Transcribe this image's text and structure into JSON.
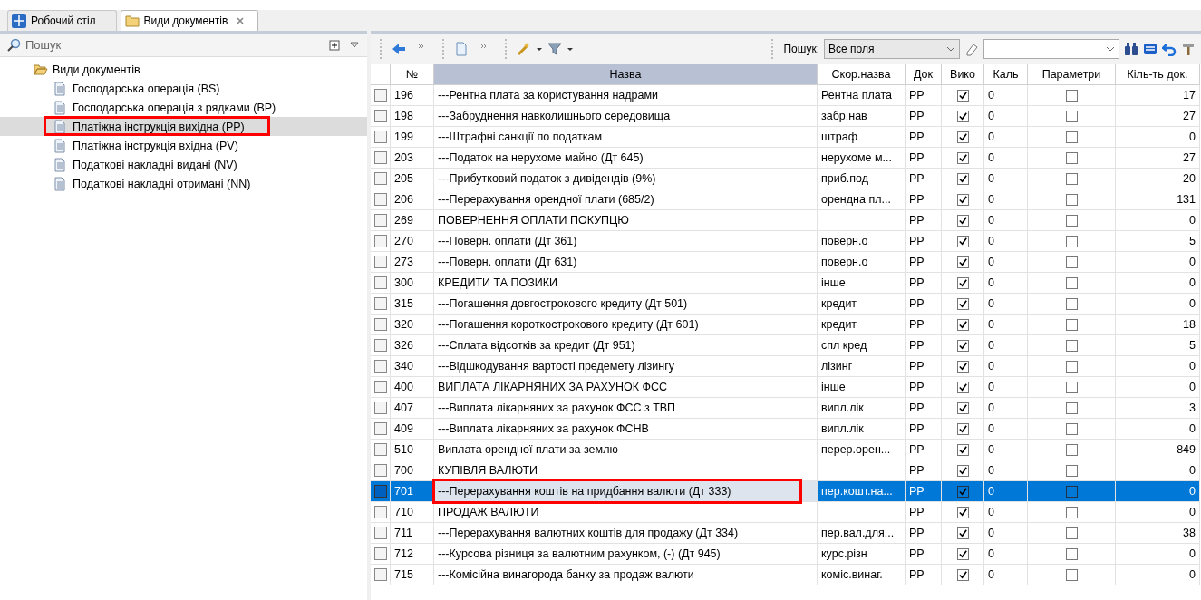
{
  "tabs": [
    {
      "label": "Робочий стіл",
      "selected": false,
      "closable": false
    },
    {
      "label": "Види документів",
      "selected": true,
      "closable": true
    }
  ],
  "left_panel": {
    "search_label": "Пошук",
    "tree": [
      {
        "label": "Види документів",
        "expanded": true,
        "children": [
          {
            "label": "Господарська операція (BS)",
            "selected": false,
            "annotated": false
          },
          {
            "label": "Господарська операція з рядками (BP)",
            "selected": false,
            "annotated": false
          },
          {
            "label": "Платіжна інструкція вихідна (PP)",
            "selected": true,
            "annotated": true
          },
          {
            "label": "Платіжна інструкція вхідна (PV)",
            "selected": false,
            "annotated": false
          },
          {
            "label": "Податкові накладні видані (NV)",
            "selected": false,
            "annotated": false
          },
          {
            "label": "Податкові накладні отримані (NN)",
            "selected": false,
            "annotated": false
          }
        ]
      }
    ]
  },
  "toolbar": {
    "search_label": "Пошук:",
    "search_scope": "Все поля"
  },
  "table": {
    "columns": [
      "№",
      "Назва",
      "Скор.назва",
      "Док",
      "Вико",
      "Каль",
      "Параметри",
      "Кіль-ть док."
    ],
    "rows": [
      {
        "num": "196",
        "name": "---Рентна плата за користування надрами",
        "short": "Рентна плата",
        "doc": "PP",
        "viko": true,
        "kal": "0",
        "params": false,
        "count": "17",
        "selected": false,
        "annotated": false
      },
      {
        "num": "198",
        "name": "---Забруднення навколишнього середовища",
        "short": "забр.нав",
        "doc": "PP",
        "viko": true,
        "kal": "0",
        "params": false,
        "count": "27",
        "selected": false,
        "annotated": false
      },
      {
        "num": "199",
        "name": "---Штрафні санкції по податкам",
        "short": "штраф",
        "doc": "PP",
        "viko": true,
        "kal": "0",
        "params": false,
        "count": "0",
        "selected": false,
        "annotated": false
      },
      {
        "num": "203",
        "name": "---Податок на нерухоме майно (Дт 645)",
        "short": "нерухоме м...",
        "doc": "PP",
        "viko": true,
        "kal": "0",
        "params": false,
        "count": "27",
        "selected": false,
        "annotated": false
      },
      {
        "num": "205",
        "name": "---Прибутковий податок з дивідендів (9%)",
        "short": "приб.под",
        "doc": "PP",
        "viko": true,
        "kal": "0",
        "params": false,
        "count": "20",
        "selected": false,
        "annotated": false
      },
      {
        "num": "206",
        "name": "---Перерахування орендної плати (685/2)",
        "short": "орендна пл...",
        "doc": "PP",
        "viko": true,
        "kal": "0",
        "params": false,
        "count": "131",
        "selected": false,
        "annotated": false
      },
      {
        "num": "269",
        "name": "ПОВЕРНЕННЯ ОПЛАТИ ПОКУПЦЮ",
        "doc": "PP",
        "viko": true,
        "kal": "0",
        "params": false,
        "count": "0",
        "selected": false,
        "annotated": false
      },
      {
        "num": "270",
        "name": "---Поверн. оплати (Дт 361)",
        "short": "поверн.о",
        "doc": "PP",
        "viko": true,
        "kal": "0",
        "params": false,
        "count": "5",
        "selected": false,
        "annotated": false
      },
      {
        "num": "273",
        "name": "---Поверн. оплати (Дт 631)",
        "short": "поверн.о",
        "doc": "PP",
        "viko": true,
        "kal": "0",
        "params": false,
        "count": "0",
        "selected": false,
        "annotated": false
      },
      {
        "num": "300",
        "name": "КРЕДИТИ ТА ПОЗИКИ",
        "short": "інше",
        "doc": "PP",
        "viko": true,
        "kal": "0",
        "params": false,
        "count": "0",
        "selected": false,
        "annotated": false
      },
      {
        "num": "315",
        "name": "---Погашення довгострокового кредиту (Дт 501)",
        "short": "кредит",
        "doc": "PP",
        "viko": true,
        "kal": "0",
        "params": false,
        "count": "0",
        "selected": false,
        "annotated": false
      },
      {
        "num": "320",
        "name": "---Погашення короткострокового кредиту (Дт 601)",
        "short": "кредит",
        "doc": "PP",
        "viko": true,
        "kal": "0",
        "params": false,
        "count": "18",
        "selected": false,
        "annotated": false
      },
      {
        "num": "326",
        "name": "---Сплата відсотків за кредит (Дт 951)",
        "short": "спл кред",
        "doc": "PP",
        "viko": true,
        "kal": "0",
        "params": false,
        "count": "5",
        "selected": false,
        "annotated": false
      },
      {
        "num": "340",
        "name": "---Відшкодування вартості предемету лізингу",
        "short": "лізинг",
        "doc": "PP",
        "viko": true,
        "kal": "0",
        "params": false,
        "count": "0",
        "selected": false,
        "annotated": false
      },
      {
        "num": "400",
        "name": "ВИПЛАТА ЛІКАРНЯНИХ ЗА РАХУНОК ФСС",
        "short": "інше",
        "doc": "PP",
        "viko": true,
        "kal": "0",
        "params": false,
        "count": "0",
        "selected": false,
        "annotated": false
      },
      {
        "num": "407",
        "name": "---Виплата лікарняних за рахунок ФСС з ТВП",
        "short": "випл.лік",
        "doc": "PP",
        "viko": true,
        "kal": "0",
        "params": false,
        "count": "3",
        "selected": false,
        "annotated": false
      },
      {
        "num": "409",
        "name": "---Виплата лікарняних за рахунок ФСНВ",
        "short": "випл.лік",
        "doc": "PP",
        "viko": true,
        "kal": "0",
        "params": false,
        "count": "0",
        "selected": false,
        "annotated": false
      },
      {
        "num": "510",
        "name": "Виплата орендної плати за землю",
        "short": "перер.орен...",
        "doc": "PP",
        "viko": true,
        "kal": "0",
        "params": false,
        "count": "849",
        "selected": false,
        "annotated": false
      },
      {
        "num": "700",
        "name": "КУПІВЛЯ ВАЛЮТИ",
        "doc": "PP",
        "viko": true,
        "kal": "0",
        "params": false,
        "count": "0",
        "selected": false,
        "annotated": false
      },
      {
        "num": "701",
        "name": "---Перерахування коштів на придбання валюти (Дт 333)",
        "short": "пер.кошт.на...",
        "doc": "PP",
        "viko": true,
        "kal": "0",
        "params": false,
        "count": "0",
        "selected": true,
        "annotated": true
      },
      {
        "num": "710",
        "name": "ПРОДАЖ ВАЛЮТИ",
        "doc": "PP",
        "viko": true,
        "kal": "0",
        "params": false,
        "count": "0",
        "selected": false,
        "annotated": false
      },
      {
        "num": "711",
        "name": "---Перерахування валютних коштів для продажу (Дт 334)",
        "short": "пер.вал.для...",
        "doc": "PP",
        "viko": true,
        "kal": "0",
        "params": false,
        "count": "38",
        "selected": false,
        "annotated": false
      },
      {
        "num": "712",
        "name": "---Курсова різниця за валютним рахунком, (-) (Дт 945)",
        "short": "курс.різн",
        "doc": "PP",
        "viko": true,
        "kal": "0",
        "params": false,
        "count": "0",
        "selected": false,
        "annotated": false
      },
      {
        "num": "715",
        "name": "---Комісійна винагорода банку за продаж валюти",
        "short": "коміс.винаг.",
        "doc": "PP",
        "viko": true,
        "kal": "0",
        "params": false,
        "count": "0",
        "selected": false,
        "annotated": false
      }
    ]
  }
}
